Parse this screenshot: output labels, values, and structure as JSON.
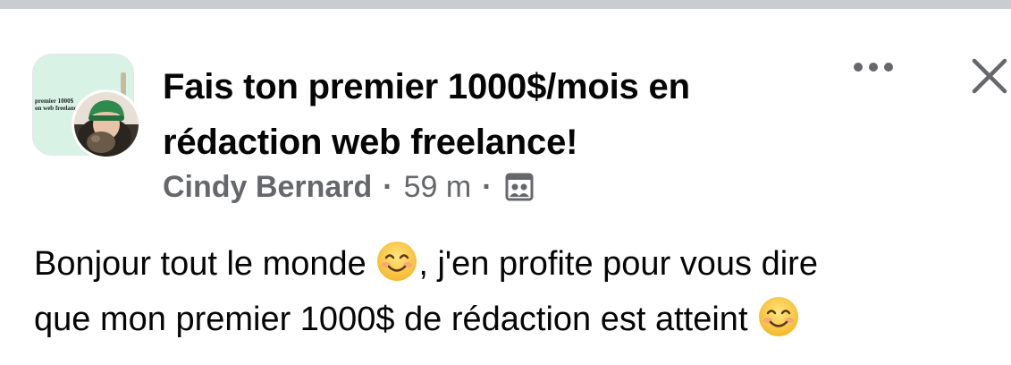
{
  "post": {
    "group_avatar_text_line1": "premier 1000$",
    "group_avatar_text_line2": "on web freelance",
    "title_line1": "Fais ton premier 1000$/mois en",
    "title_line2": "rédaction web freelance!",
    "author": "Cindy Bernard",
    "separator": "·",
    "time": "59 m",
    "audience_icon": "group-audience-icon",
    "body_line1_start": "Bonjour tout le monde ",
    "body_line1_end": ", j'en profite pour vous dire",
    "body_line2": "que mon premier 1000$ de rédaction est atteint ",
    "emoji": "smiling-face-emoji"
  },
  "actions": {
    "more_icon": "more-options-icon",
    "close_icon": "close-icon"
  },
  "colors": {
    "divider": "#c9ccd1",
    "text_primary": "#050505",
    "text_secondary": "#65676b",
    "group_avatar_bg": "#d9f2e6"
  }
}
